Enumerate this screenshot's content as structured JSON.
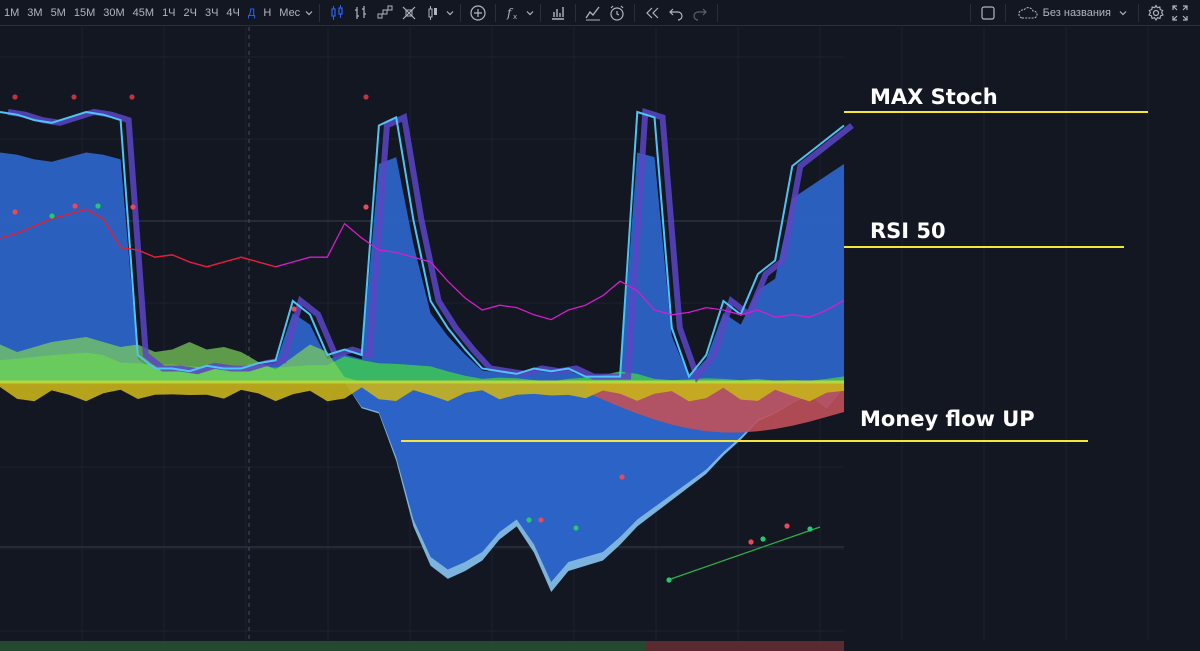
{
  "toolbar": {
    "intervals": [
      "1M",
      "3M",
      "5M",
      "15M",
      "30M",
      "45M",
      "1Ч",
      "2Ч",
      "3Ч",
      "4Ч",
      "Д",
      "Н",
      "Мес"
    ],
    "active_interval": "Д",
    "icons": [
      "chevron-down-icon",
      "candles-icon",
      "bars-icon",
      "renko-icon",
      "hollow-candles-icon",
      "chevron-down-icon",
      "add-indicator-icon",
      "formula-icon",
      "chevron-down-icon",
      "bar-chart-icon",
      "line-chart-icon",
      "alert-clock-icon",
      "replay-icon",
      "undo-icon",
      "redo-icon"
    ],
    "layout_name": "Без названия",
    "right_icons": [
      "square-icon",
      "cloud-icon",
      "chevron-down-icon",
      "gear-icon",
      "fullscreen-icon"
    ]
  },
  "annotations": [
    {
      "label": "MAX Stoch"
    },
    {
      "label": "RSI 50"
    },
    {
      "label": "Money flow UP"
    }
  ],
  "colors": {
    "background": "#131722",
    "annotation_line": "#f7e53a",
    "stoch_light": "#4fc3f7",
    "stoch_dark": "#5b45c4",
    "rsi": "#d21ecd",
    "rsi_red": "#e0202a",
    "money_green": "#3cc15a",
    "money_yellow": "#c9b21c",
    "money_blue": "#2b63c7",
    "money_red": "#c0505a"
  },
  "chart_data": {
    "type": "area",
    "series": [
      {
        "values": [
          1.0,
          0.99,
          0.97,
          0.96,
          0.98,
          1.0,
          0.99,
          0.97,
          0.1,
          0.05,
          0.05,
          0.04,
          0.06,
          0.05,
          0.05,
          0.07,
          0.08,
          0.3,
          0.25,
          0.1,
          0.12,
          0.1,
          0.95,
          0.98,
          0.6,
          0.3,
          0.2,
          0.12,
          0.05,
          0.04,
          0.03,
          0.05,
          0.04,
          0.05,
          0.02,
          0.02,
          0.02,
          1.0,
          0.98,
          0.2,
          0.02,
          0.1,
          0.3,
          0.25,
          0.4,
          0.45,
          0.8,
          0.85,
          0.9,
          0.95
        ]
      },
      {
        "values": [
          0.6,
          0.62,
          0.65,
          0.68,
          0.7,
          0.72,
          0.68,
          0.56,
          0.55,
          0.52,
          0.53,
          0.5,
          0.48,
          0.5,
          0.52,
          0.5,
          0.48,
          0.5,
          0.52,
          0.52,
          0.66,
          0.6,
          0.55,
          0.54,
          0.52,
          0.5,
          0.42,
          0.35,
          0.3,
          0.32,
          0.31,
          0.28,
          0.26,
          0.3,
          0.32,
          0.36,
          0.42,
          0.38,
          0.3,
          0.28,
          0.29,
          0.31,
          0.3,
          0.28,
          0.3,
          0.27,
          0.28,
          0.27,
          0.3,
          0.34
        ]
      },
      {
        "values": [
          0.15,
          0.12,
          0.14,
          0.16,
          0.17,
          0.18,
          0.16,
          0.14,
          0.15,
          0.12,
          0.13,
          0.16,
          0.13,
          0.14,
          0.12,
          0.08,
          0.05,
          0.1,
          0.15,
          0.12,
          0.02,
          -0.1,
          -0.12,
          -0.3,
          -0.55,
          -0.7,
          -0.75,
          -0.72,
          -0.68,
          -0.6,
          -0.55,
          -0.65,
          -0.8,
          -0.72,
          -0.7,
          -0.68,
          -0.62,
          -0.55,
          -0.5,
          -0.45,
          -0.4,
          -0.35,
          -0.28,
          -0.22,
          -0.15,
          -0.12,
          -0.08,
          -0.05,
          -0.1,
          -0.02
        ]
      }
    ]
  }
}
